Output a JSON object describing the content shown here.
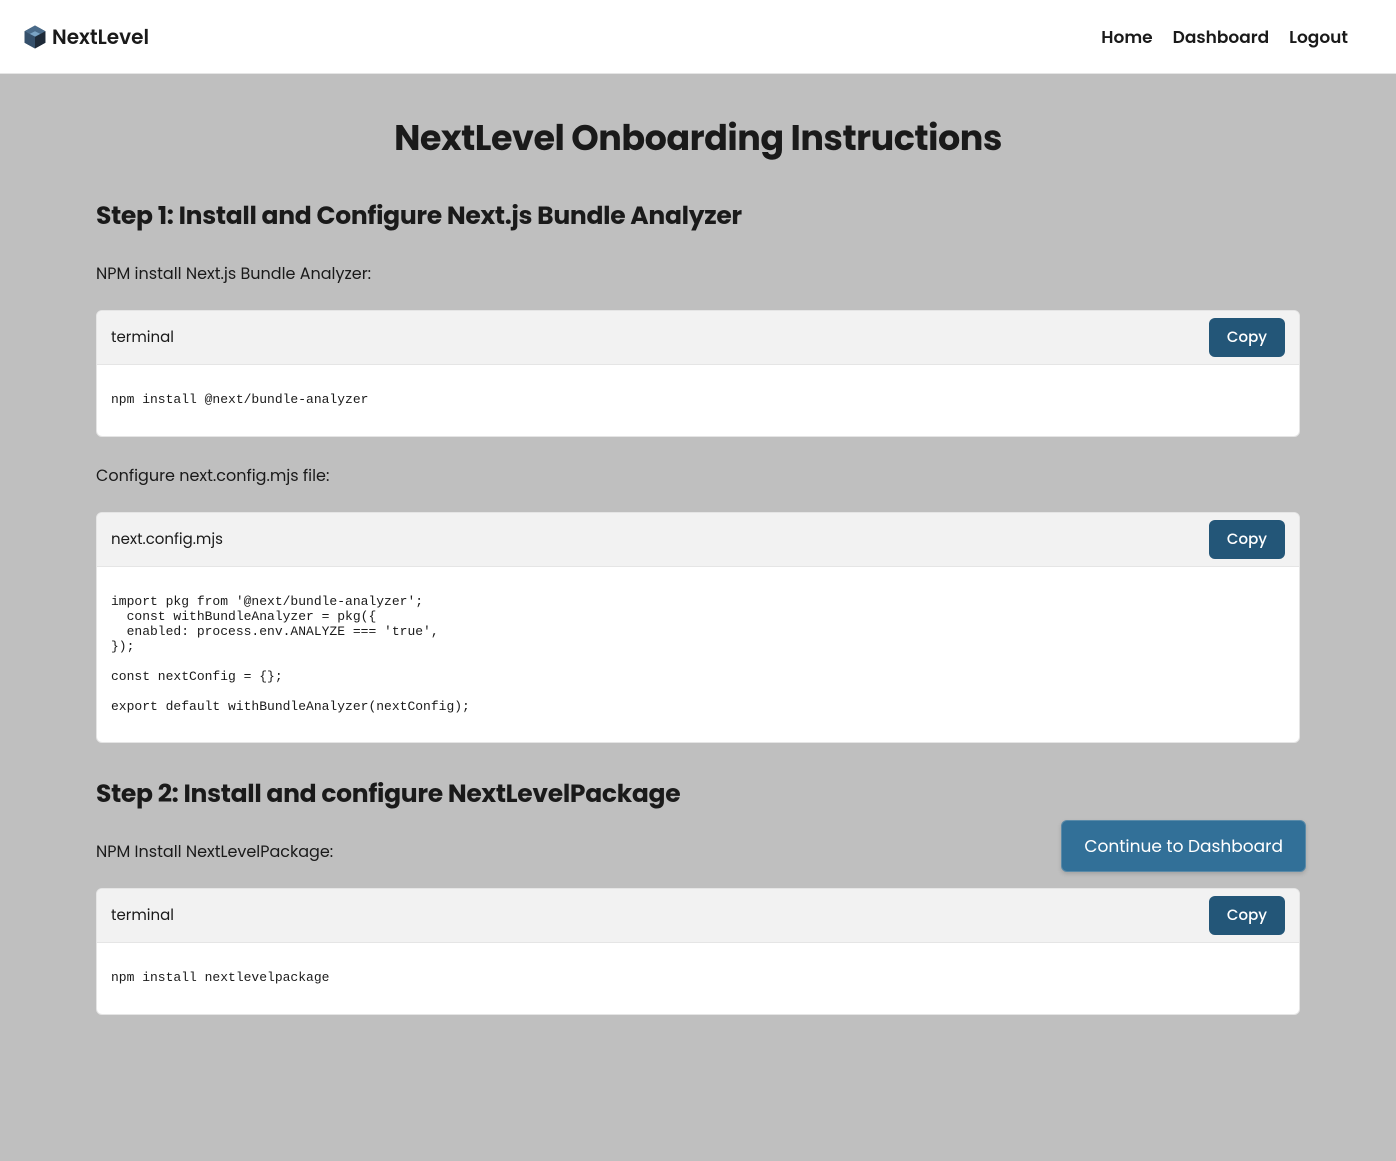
{
  "header": {
    "brand": "NextLevel",
    "nav": {
      "home": "Home",
      "dashboard": "Dashboard",
      "logout": "Logout"
    }
  },
  "page": {
    "title": "NextLevel Onboarding Instructions"
  },
  "steps": [
    {
      "title": "Step 1: Install and Configure Next.js Bundle Analyzer",
      "blocks": [
        {
          "desc": "NPM install Next.js Bundle Analyzer:",
          "filename": "terminal",
          "copyLabel": "Copy",
          "code": "npm install @next/bundle-analyzer"
        },
        {
          "desc": "Configure next.config.mjs file:",
          "filename": "next.config.mjs",
          "copyLabel": "Copy",
          "code": "import pkg from '@next/bundle-analyzer';\n  const withBundleAnalyzer = pkg({\n  enabled: process.env.ANALYZE === 'true',\n});\n\nconst nextConfig = {};\n\nexport default withBundleAnalyzer(nextConfig);"
        }
      ]
    },
    {
      "title": "Step 2: Install and configure NextLevelPackage",
      "blocks": [
        {
          "desc": "NPM Install NextLevelPackage:",
          "filename": "terminal",
          "copyLabel": "Copy",
          "code": "npm install nextlevelpackage"
        }
      ]
    }
  ],
  "floating": {
    "continueLabel": "Continue to Dashboard"
  }
}
